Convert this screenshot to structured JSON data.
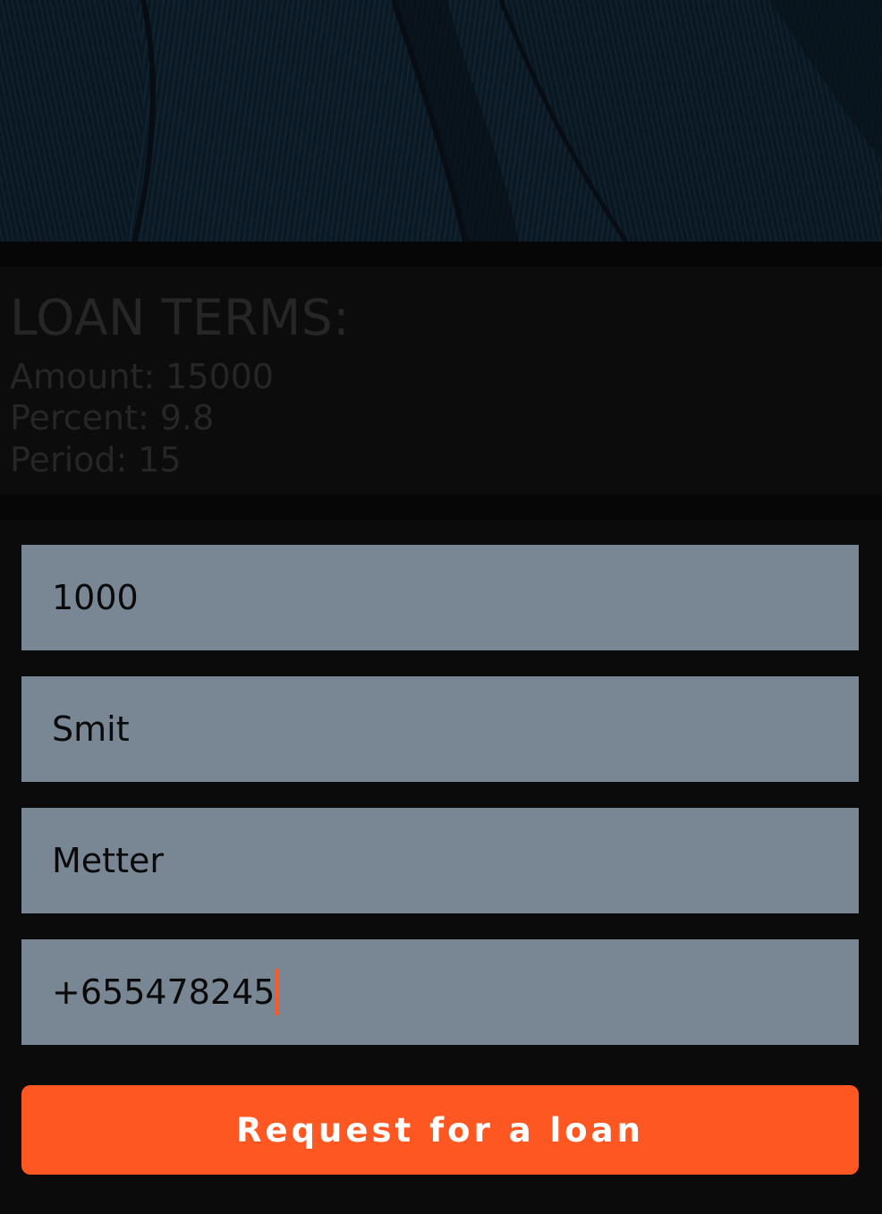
{
  "terms": {
    "title": "LOAN TERMS:",
    "amount": "Amount: 15000",
    "percent": "Percent: 9.8",
    "period": "Period: 15"
  },
  "form": {
    "amount_value": "1000",
    "first_name_value": "Smit",
    "last_name_value": "Metter",
    "phone_value": "+655478245"
  },
  "actions": {
    "request_label": "Request for a loan"
  },
  "colors": {
    "accent": "#ff5722",
    "field_bg": "#798794",
    "background": "#0b0b0b"
  }
}
